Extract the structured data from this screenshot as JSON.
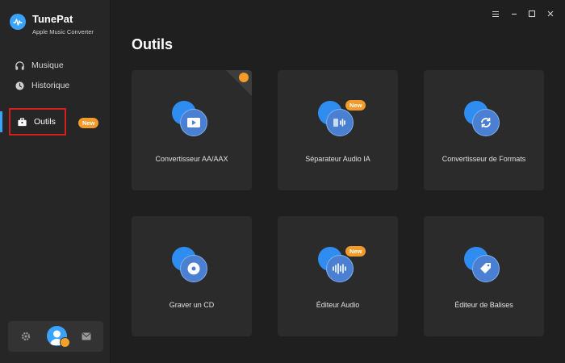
{
  "app": {
    "name": "TunePat",
    "subtitle": "Apple Music Converter",
    "accent": "#3aa3ff"
  },
  "sidebar": {
    "items": [
      {
        "label": "Musique",
        "icon": "headphones-icon"
      },
      {
        "label": "Historique",
        "icon": "clock-icon"
      },
      {
        "label": "Outils",
        "icon": "toolbox-icon",
        "badge": "New",
        "active": true
      }
    ],
    "bottom": [
      "gear-icon",
      "avatar",
      "mail-icon"
    ]
  },
  "window_controls": [
    "menu-icon",
    "minimize-icon",
    "maximize-icon",
    "close-icon"
  ],
  "main": {
    "title": "Outils",
    "tools": [
      {
        "label": "Convertisseur AA/AAX",
        "icon": "play-icon",
        "corner": true
      },
      {
        "label": "Séparateur Audio IA",
        "icon": "audio-split-icon",
        "badge": "New"
      },
      {
        "label": "Convertisseur de Formats",
        "icon": "refresh-icon"
      },
      {
        "label": "Graver un CD",
        "icon": "cd-icon"
      },
      {
        "label": "Éditeur Audio",
        "icon": "waveform-icon",
        "badge": "New"
      },
      {
        "label": "Éditeur de Balises",
        "icon": "tag-icon"
      }
    ]
  }
}
